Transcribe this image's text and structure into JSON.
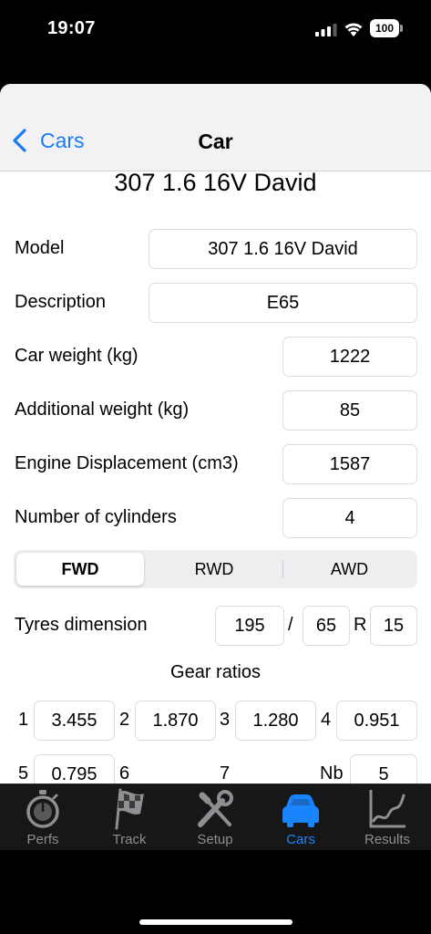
{
  "status_bar": {
    "time": "19:07",
    "battery": "100"
  },
  "nav": {
    "back_label": "Cars",
    "title": "Car"
  },
  "car": {
    "heading": "307 1.6 16V David",
    "fields": [
      {
        "label": "Model",
        "value": "307 1.6 16V David"
      },
      {
        "label": "Description",
        "value": "E65"
      },
      {
        "label": "Car weight (kg)",
        "value": "1222"
      },
      {
        "label": "Additional weight (kg)",
        "value": "85"
      },
      {
        "label": "Engine Displacement (cm3)",
        "value": "1587"
      },
      {
        "label": "Number of cylinders",
        "value": "4"
      }
    ],
    "drivetrain": {
      "options": [
        "FWD",
        "RWD",
        "AWD"
      ],
      "selected": "FWD"
    },
    "tyres": {
      "label": "Tyres dimension",
      "width": "195",
      "separator": "/",
      "aspect": "65",
      "construction": "R",
      "rim": "15"
    },
    "gears": {
      "title": "Gear ratios",
      "ratios": [
        {
          "num": "1",
          "value": "3.455"
        },
        {
          "num": "2",
          "value": "1.870"
        },
        {
          "num": "3",
          "value": "1.280"
        },
        {
          "num": "4",
          "value": "0.951"
        },
        {
          "num": "5",
          "value": "0.795"
        },
        {
          "num": "6",
          "value": ""
        },
        {
          "num": "7",
          "value": ""
        }
      ],
      "count_label": "Nb",
      "count": "5"
    }
  },
  "tabs": [
    {
      "label": "Perfs",
      "icon": "stopwatch-icon"
    },
    {
      "label": "Track",
      "icon": "checkered-flag-icon"
    },
    {
      "label": "Setup",
      "icon": "wrench-screwdriver-icon"
    },
    {
      "label": "Cars",
      "icon": "car-icon",
      "active": true
    },
    {
      "label": "Results",
      "icon": "chart-icon"
    }
  ],
  "colors": {
    "accent": "#1a84ff",
    "link": "#1a7cf0",
    "tabbar_bg": "#171717",
    "tab_inactive": "#8e8e93"
  }
}
